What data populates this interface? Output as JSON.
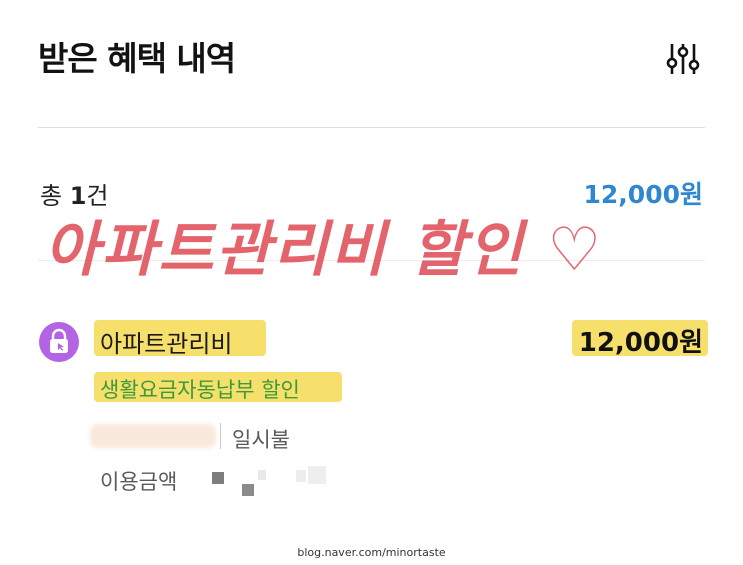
{
  "header": {
    "title": "받은 혜택 내역",
    "filter_icon": "sliders-icon"
  },
  "summary": {
    "total_prefix": "총 ",
    "total_count": "1",
    "total_suffix": "건",
    "total_amount": "12,000원"
  },
  "annotation": {
    "handwritten": "아파트관리비 할인 ♡",
    "color": "#e04a55",
    "highlight_color": "#f6dc5b"
  },
  "benefit_item": {
    "icon": "lock-icon",
    "icon_bg": "#b264e4",
    "name": "아파트관리비",
    "amount": "12,000원",
    "type": "생활요금자동납부 할인",
    "installment": "일시불",
    "usage_label": "이용금액"
  },
  "watermark": "blog.naver.com/minortaste"
}
